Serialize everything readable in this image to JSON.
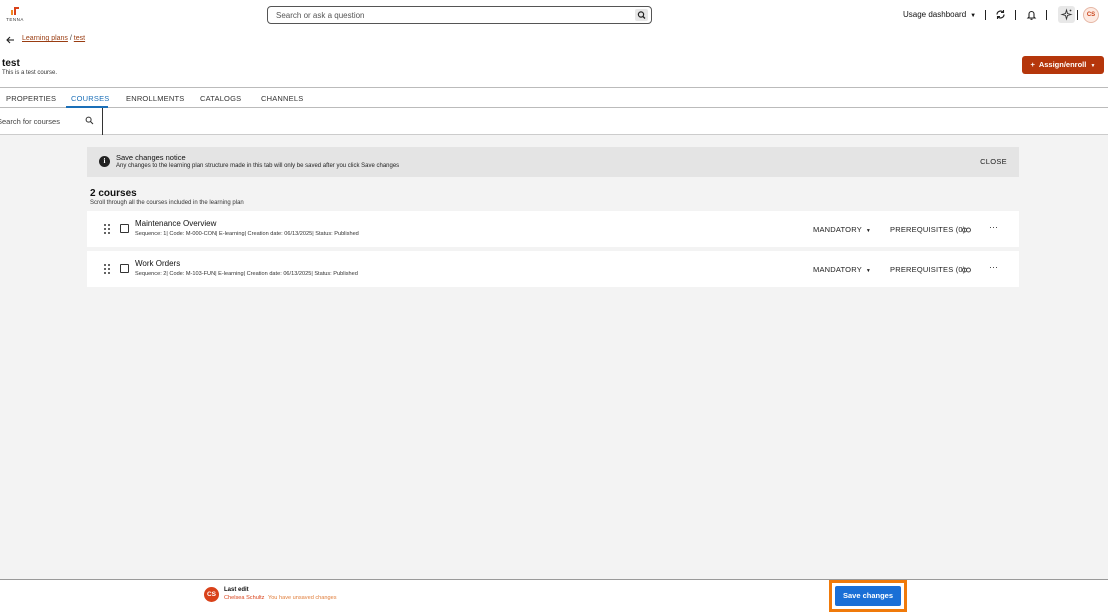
{
  "brand": {
    "word": "TENNA",
    "accent": "#d9421a"
  },
  "topbar": {
    "search_placeholder": "Search or ask a question",
    "usage_dashboard": "Usage dashboard",
    "user_initials": "CS"
  },
  "breadcrumb": {
    "parent": "Learning plans",
    "separator": "/",
    "current": "test"
  },
  "page": {
    "title": "test",
    "subtitle": "This is a test course.",
    "assign_label": "Assign/enroll"
  },
  "tabs": [
    "PROPERTIES",
    "COURSES",
    "ENROLLMENTS",
    "CATALOGS",
    "CHANNELS"
  ],
  "active_tab": "COURSES",
  "course_search": {
    "placeholder": "Search for courses"
  },
  "notice": {
    "title": "Save changes notice",
    "body": "Any changes to the learning plan structure made in this tab will only be saved after you click Save changes",
    "close_label": "CLOSE"
  },
  "courses_summary": {
    "count_label": "2 courses",
    "subtitle": "Scroll through all the courses included in the learning plan"
  },
  "courses": [
    {
      "name": "Maintenance Overview",
      "meta": "Sequence: 1| Code: M-000-CON| E-learning| Creation date: 06/13/2025| Status: Published",
      "requirement": "MANDATORY",
      "prerequisites": "PREREQUISITES (0)"
    },
    {
      "name": "Work Orders",
      "meta": "Sequence: 2| Code: M-103-FUN| E-learning| Creation date: 06/13/2025| Status: Published",
      "requirement": "MANDATORY",
      "prerequisites": "PREREQUISITES (0)"
    }
  ],
  "footer": {
    "initials": "CS",
    "last_edit_label": "Last edit",
    "editor_name": "Chelsea Schultz",
    "unsaved_text": "You have unsaved changes",
    "save_label": "Save changes"
  },
  "colors": {
    "primary_blue": "#1a6fd6",
    "assign_button": "#b5360b",
    "highlight_frame": "#f07a0a",
    "tab_active": "#1a6fb8"
  },
  "icons": [
    "logo-mark-icon",
    "search-icon",
    "caret-down-icon",
    "refresh-icon",
    "bell-icon",
    "sparkle-icon",
    "back-arrow-icon",
    "plus-icon",
    "info-icon",
    "drag-handle-icon",
    "link-icon",
    "more-icon"
  ]
}
